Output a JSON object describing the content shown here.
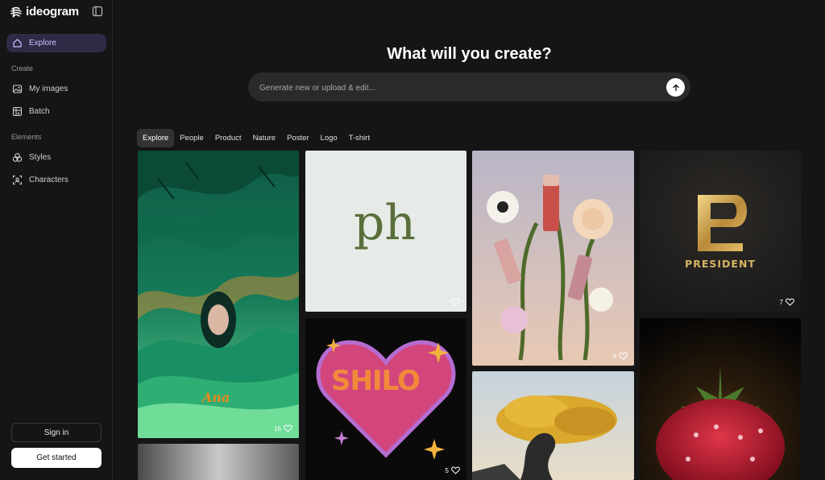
{
  "brand": {
    "name": "ideogram"
  },
  "sidebar": {
    "explore_label": "Explore",
    "create_section": "Create",
    "my_images_label": "My images",
    "batch_label": "Batch",
    "elements_section": "Elements",
    "styles_label": "Styles",
    "characters_label": "Characters",
    "sign_in_label": "Sign in",
    "get_started_label": "Get started"
  },
  "hero": {
    "title": "What will you create?",
    "placeholder": "Generate new or upload & edit..."
  },
  "tabs": [
    "Explore",
    "People",
    "Product",
    "Nature",
    "Poster",
    "Logo",
    "T-shirt"
  ],
  "gallery": {
    "card1": {
      "likes": "16",
      "text": "Ana"
    },
    "card2": {
      "likes": "",
      "text": "ph"
    },
    "card3": {
      "likes": "9"
    },
    "card4": {
      "likes": "7",
      "text": "PRESIDENT"
    },
    "card5": {
      "likes": "5",
      "text": "SHILO"
    }
  },
  "colors": {
    "accent": "#2f2b47",
    "accent_text": "#c8c2ff",
    "bg": "#151515"
  }
}
